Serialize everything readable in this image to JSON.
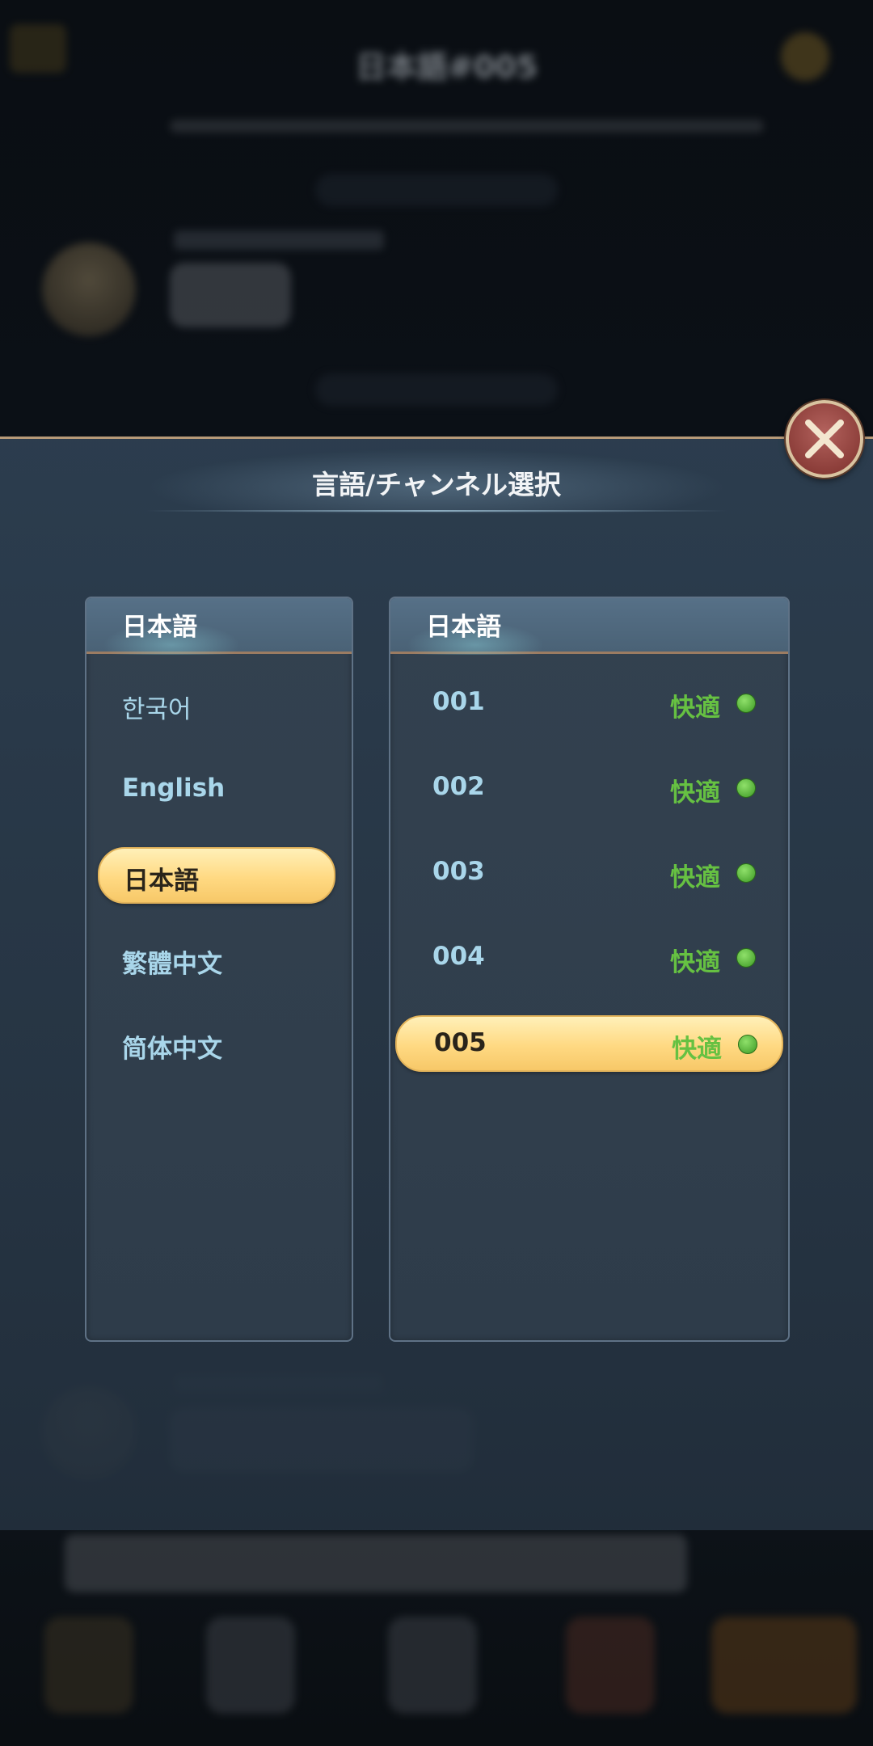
{
  "background": {
    "header_title": "日本語#005"
  },
  "dialog": {
    "title": "言語/チャンネル選択"
  },
  "language_panel": {
    "header": "日本語",
    "items": [
      {
        "label": "한국어"
      },
      {
        "label": "English"
      },
      {
        "label": "日本語",
        "selected": true
      },
      {
        "label": "繁體中文"
      },
      {
        "label": "简体中文"
      }
    ]
  },
  "channel_panel": {
    "header": "日本語",
    "items": [
      {
        "number": "001",
        "status": "快適"
      },
      {
        "number": "002",
        "status": "快適"
      },
      {
        "number": "003",
        "status": "快適"
      },
      {
        "number": "004",
        "status": "快適"
      },
      {
        "number": "005",
        "status": "快適",
        "selected": true
      }
    ]
  },
  "colors": {
    "selected_fill": "#ffd982",
    "status_green": "#66c142",
    "item_text": "#a9d6ea",
    "close_button": "#9b4642"
  },
  "icons": {
    "close": "close-icon",
    "status": "status-dot-icon"
  }
}
